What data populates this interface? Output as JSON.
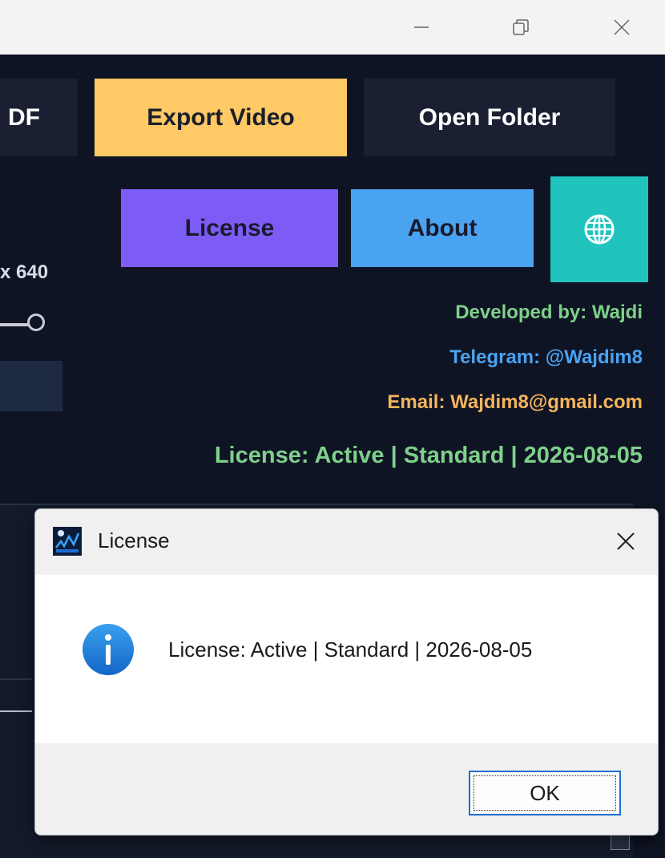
{
  "window": {
    "controls": [
      "minimize",
      "maximize",
      "close"
    ]
  },
  "toolbar": {
    "pdf_label": "DF",
    "export_label": "Export Video",
    "open_folder_label": "Open Folder",
    "license_label": "License",
    "about_label": "About"
  },
  "settings": {
    "resolution_value": "640"
  },
  "credits": {
    "developer": "Developed by: Wajdi",
    "telegram": "Telegram: @Wajdim8",
    "email": "Email: Wajdim8@gmail.com",
    "license_status": "License: Active | Standard | 2026-08-05"
  },
  "dialog": {
    "title": "License",
    "message": "License: Active | Standard | 2026-08-05",
    "ok_label": "OK",
    "icon": "info-icon"
  },
  "colors": {
    "export": "#ffc965",
    "license": "#7d5cf5",
    "about": "#4aa3f0",
    "globe": "#20c4bd",
    "developer_text": "#7ed08a",
    "telegram_text": "#4aa3f0",
    "email_text": "#f5b45c"
  }
}
